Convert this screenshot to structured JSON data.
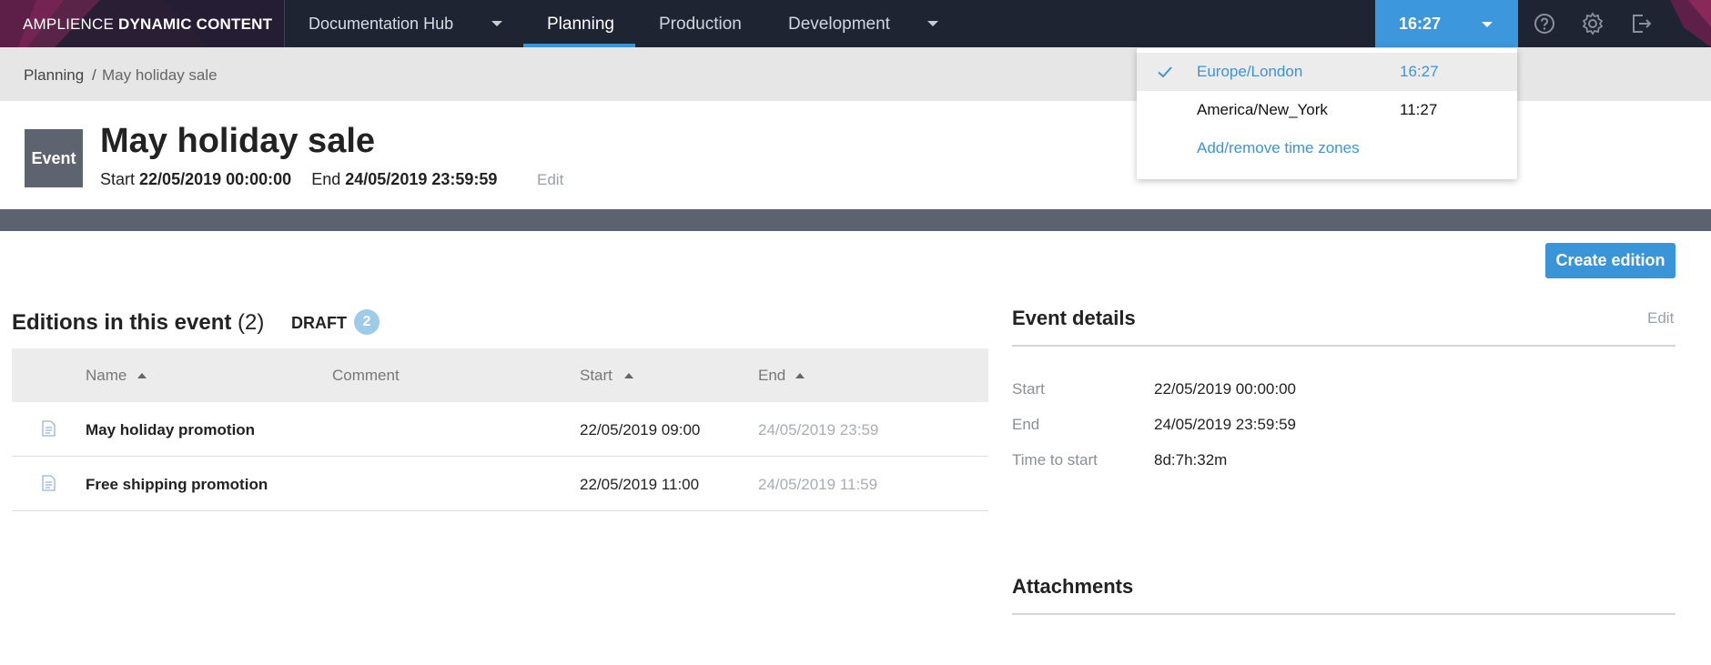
{
  "nav": {
    "brand_light": "AMPLIENCE",
    "brand_bold": "DYNAMIC CONTENT",
    "hub": "Documentation Hub",
    "tabs": [
      "Planning",
      "Production",
      "Development"
    ],
    "active_tab": "Planning",
    "timezone_time": "16:27",
    "icons": [
      "help-icon",
      "settings-icon",
      "logout-icon"
    ]
  },
  "breadcrumb": {
    "root": "Planning",
    "separator": "/",
    "current": "May holiday sale"
  },
  "event": {
    "tag": "Event",
    "title": "May holiday sale",
    "start_label": "Start",
    "start": "22/05/2019 00:00:00",
    "end_label": "End",
    "end": "24/05/2019 23:59:59",
    "edit": "Edit"
  },
  "timezone_menu": {
    "items": [
      {
        "name": "Europe/London",
        "time": "16:27",
        "selected": true
      },
      {
        "name": "America/New_York",
        "time": "11:27",
        "selected": false
      }
    ],
    "add_remove": "Add/remove time zones"
  },
  "create_button": "Create edition",
  "editions": {
    "title": "Editions in this event",
    "count": "(2)",
    "status_label": "DRAFT",
    "status_count": "2",
    "columns": [
      "Name",
      "Comment",
      "Start",
      "End"
    ],
    "rows": [
      {
        "name": "May holiday promotion",
        "comment": "",
        "start": "22/05/2019 09:00",
        "end": "24/05/2019 23:59"
      },
      {
        "name": "Free shipping promotion",
        "comment": "",
        "start": "22/05/2019 11:00",
        "end": "24/05/2019 11:59"
      }
    ]
  },
  "details": {
    "title": "Event details",
    "edit": "Edit",
    "fields": [
      {
        "label": "Start",
        "value": "22/05/2019 00:00:00"
      },
      {
        "label": "End",
        "value": "24/05/2019 23:59:59"
      },
      {
        "label": "Time to start",
        "value": "8d:7h:32m"
      }
    ],
    "attachments_title": "Attachments"
  },
  "colors": {
    "accent": "#3a94d8",
    "nav_bg": "#1f2433",
    "band": "#5c636e"
  }
}
